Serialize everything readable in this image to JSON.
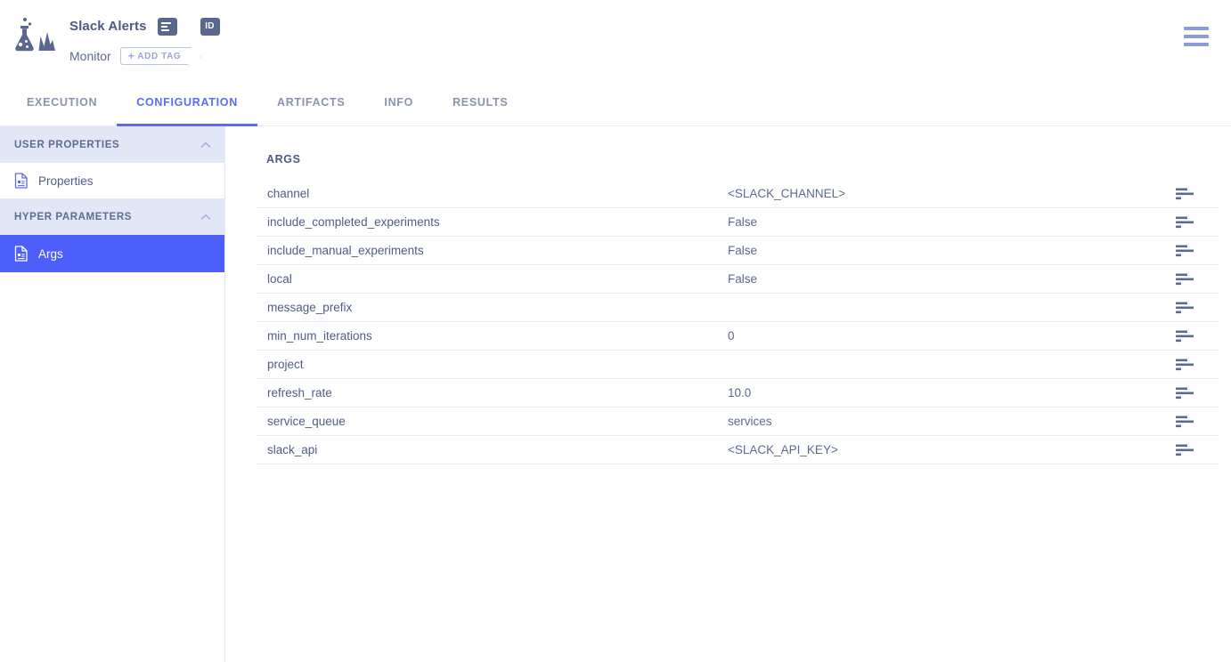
{
  "header": {
    "logo_alt": "clearml-logo",
    "task_title": "Slack Alerts",
    "task_type": "Monitor",
    "id_button_label": "ID",
    "add_tag_label": "ADD TAG",
    "add_tag_plus": "+",
    "menu_label": "menu"
  },
  "tabs": [
    {
      "label": "EXECUTION",
      "active": false
    },
    {
      "label": "CONFIGURATION",
      "active": true
    },
    {
      "label": "ARTIFACTS",
      "active": false
    },
    {
      "label": "INFO",
      "active": false
    },
    {
      "label": "RESULTS",
      "active": false
    }
  ],
  "sidebar": {
    "sections": [
      {
        "title": "USER PROPERTIES",
        "items": [
          {
            "label": "Properties",
            "selected": false
          }
        ]
      },
      {
        "title": "HYPER PARAMETERS",
        "items": [
          {
            "label": "Args",
            "selected": true
          }
        ]
      }
    ]
  },
  "main": {
    "section_title": "ARGS",
    "rows": [
      {
        "name": "channel",
        "value": "<SLACK_CHANNEL>"
      },
      {
        "name": "include_completed_experiments",
        "value": "False"
      },
      {
        "name": "include_manual_experiments",
        "value": "False"
      },
      {
        "name": "local",
        "value": "False"
      },
      {
        "name": "message_prefix",
        "value": ""
      },
      {
        "name": "min_num_iterations",
        "value": "0"
      },
      {
        "name": "project",
        "value": ""
      },
      {
        "name": "refresh_rate",
        "value": "10.0"
      },
      {
        "name": "service_queue",
        "value": "services"
      },
      {
        "name": "slack_api",
        "value": "<SLACK_API_KEY>"
      }
    ]
  },
  "colors": {
    "accent": "#5a6cf5",
    "selected_item": "#4c5ffa",
    "section_header_bg": "#e2e7f8",
    "text_primary": "#4f5c85",
    "text_muted": "#8a93ad",
    "hamburger": "#8a9cd3"
  }
}
